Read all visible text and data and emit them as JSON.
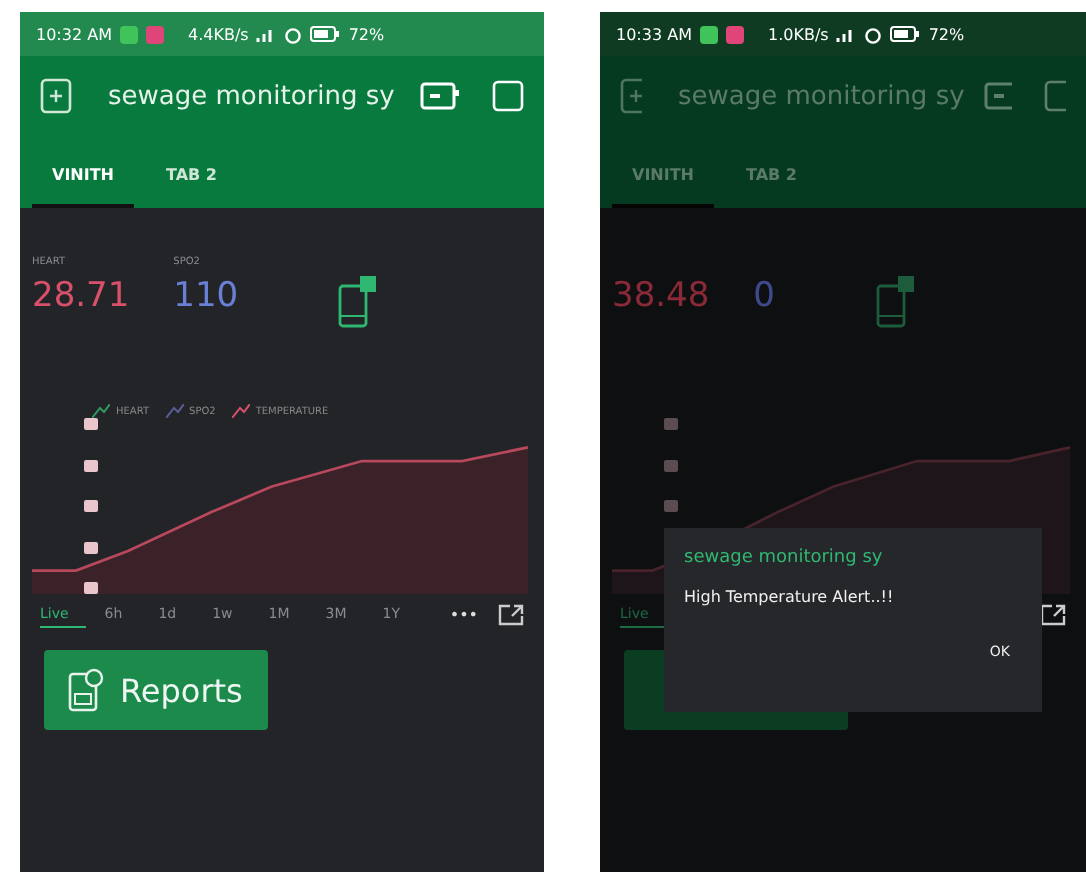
{
  "screens": [
    {
      "dimmed": false,
      "status_bar": {
        "time": "10:32 AM",
        "speed": "4.4KB/s",
        "battery": "72%"
      },
      "app_bar": {
        "title": "sewage monitoring sy"
      },
      "tabs": [
        {
          "label": "VINITH",
          "selected": true
        },
        {
          "label": "TAB 2",
          "selected": false
        }
      ],
      "readings": [
        {
          "label": "HEART",
          "value": "28.71",
          "color": "#d9506a"
        },
        {
          "label": "SPO2",
          "value": "110",
          "color": "#6a7fd6"
        }
      ],
      "chart": {
        "legend": [
          {
            "label": "HEART",
            "color": "#2f9a62"
          },
          {
            "label": "SPO2",
            "color": "#5a5f9a"
          },
          {
            "label": "TEMPERATURE",
            "color": "#d9506a"
          }
        ],
        "ranges": [
          {
            "label": "Live",
            "selected": true
          },
          {
            "label": "6h",
            "selected": false
          },
          {
            "label": "1d",
            "selected": false
          },
          {
            "label": "1w",
            "selected": false
          },
          {
            "label": "1M",
            "selected": false
          },
          {
            "label": "3M",
            "selected": false
          },
          {
            "label": "1Y",
            "selected": false
          }
        ],
        "menu": "•••"
      },
      "reports_button": {
        "label": "Reports"
      }
    },
    {
      "dimmed": true,
      "status_bar": {
        "time": "10:33 AM",
        "speed": "1.0KB/s",
        "battery": "72%"
      },
      "app_bar": {
        "title": "sewage monitoring sy"
      },
      "tabs": [
        {
          "label": "VINITH",
          "selected": true
        },
        {
          "label": "TAB 2",
          "selected": false
        }
      ],
      "readings": [
        {
          "value": "38.48",
          "color": "#8a2a38"
        },
        {
          "value": "0",
          "color": "#3e4a8c"
        }
      ],
      "chart": {
        "ranges": [
          {
            "label": "Live",
            "selected": true
          }
        ]
      },
      "dialog": {
        "title": "sewage monitoring sy",
        "message": "High Temperature Alert..!!",
        "button": "OK"
      }
    }
  ]
}
